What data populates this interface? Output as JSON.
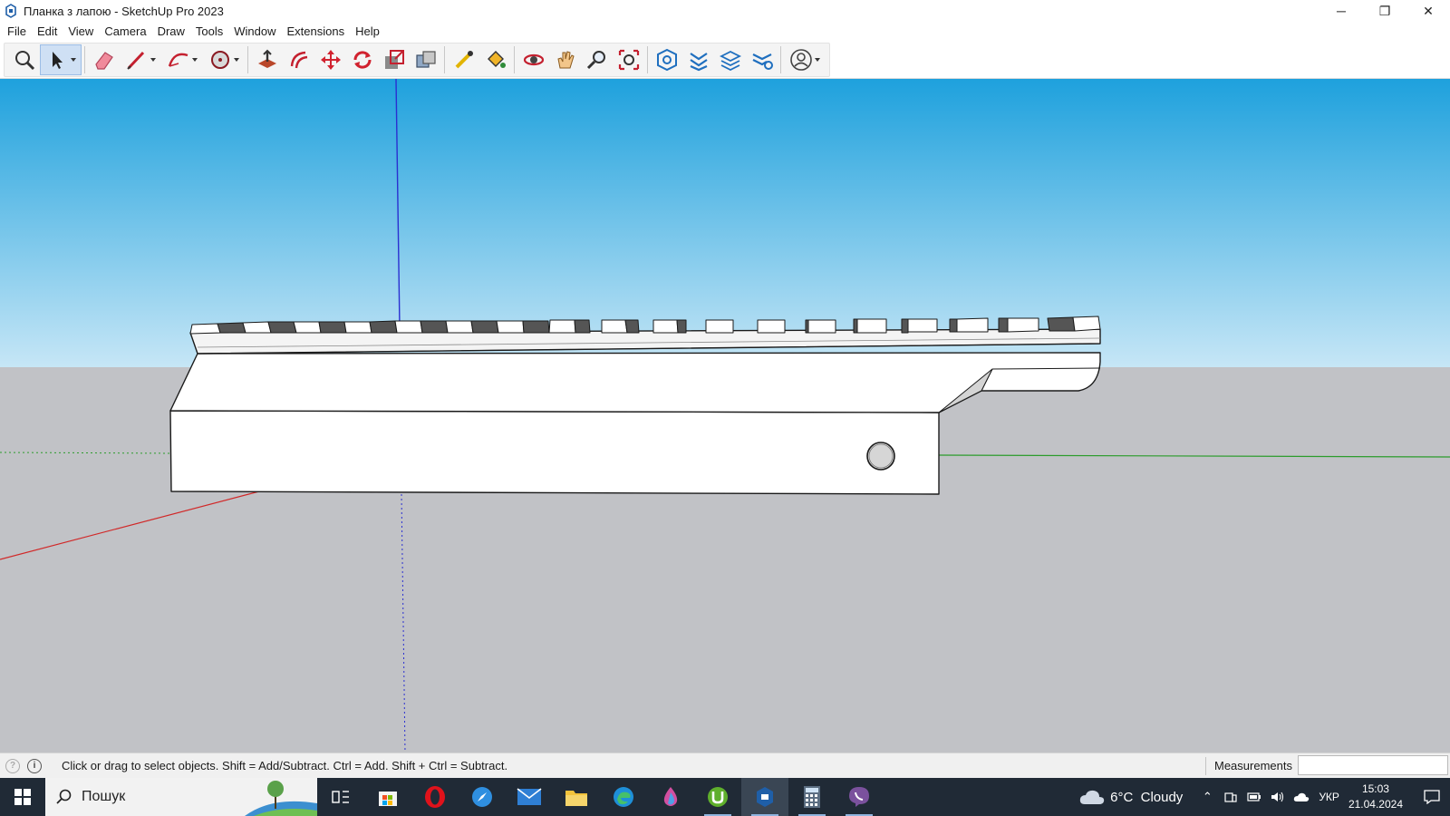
{
  "window": {
    "title": "Планка з лапою - SketchUp Pro 2023",
    "controls": {
      "minimize": "─",
      "restore": "❐",
      "close": "✕"
    }
  },
  "menu": [
    "File",
    "Edit",
    "View",
    "Camera",
    "Draw",
    "Tools",
    "Window",
    "Extensions",
    "Help"
  ],
  "toolbar": {
    "tools": [
      "zoom-window-icon",
      "select-icon",
      "eraser-icon",
      "pencil-line-icon",
      "arc-icon",
      "circle-icon",
      "push-pull-icon",
      "offset-icon",
      "move-icon",
      "rotate-icon",
      "scale-icon",
      "solid-tools-icon",
      "tape-measure-icon",
      "paint-bucket-icon",
      "orbit-icon",
      "pan-icon",
      "zoom-icon",
      "zoom-extents-icon",
      "warehouse-icon",
      "extension-warehouse-icon",
      "layout-icon",
      "extension-manager-icon",
      "profile-icon"
    ],
    "active_tool": "select-icon"
  },
  "viewport": {
    "sky_top": "#1ea1dd",
    "sky_bottom": "#c6e6f6",
    "ground": "#c1c2c6",
    "axis_blue": "#2a2fd1",
    "axis_red": "#d12828",
    "axis_green": "#2c9c2c"
  },
  "status": {
    "hint": "Click or drag to select objects. Shift = Add/Subtract. Ctrl = Add. Shift + Ctrl = Subtract.",
    "measurements_label": "Measurements",
    "measurements_value": ""
  },
  "taskbar": {
    "search_placeholder": "Пошук",
    "apps": [
      "task-view-icon",
      "store-icon",
      "opera-icon",
      "safari-icon",
      "mail-icon",
      "explorer-icon",
      "edge-icon",
      "paint-icon",
      "utorrent-icon",
      "sketchup-icon",
      "calculator-icon",
      "viber-icon"
    ],
    "active_app": "sketchup-icon",
    "weather": "6°C  Cloudy",
    "language": "УКР",
    "time": "15:03",
    "date": "21.04.2024"
  }
}
